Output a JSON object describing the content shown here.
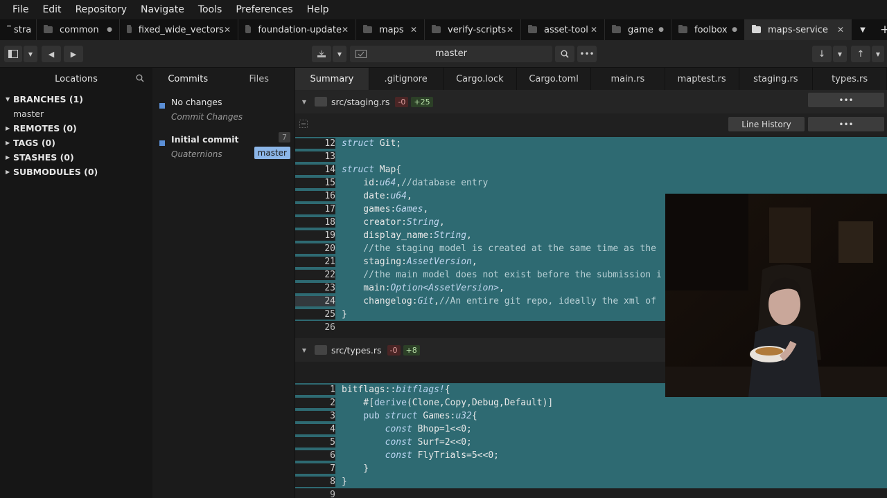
{
  "menu": [
    "File",
    "Edit",
    "Repository",
    "Navigate",
    "Tools",
    "Preferences",
    "Help"
  ],
  "tabs": [
    {
      "label": "stra",
      "mark": "",
      "active": false
    },
    {
      "label": "common",
      "mark": "●",
      "active": false
    },
    {
      "label": "fixed_wide_vectors",
      "mark": "✕",
      "active": false
    },
    {
      "label": "foundation-update",
      "mark": "✕",
      "active": false
    },
    {
      "label": "maps",
      "mark": "✕",
      "active": false
    },
    {
      "label": "verify-scripts",
      "mark": "✕",
      "active": false
    },
    {
      "label": "asset-tool",
      "mark": "✕",
      "active": false
    },
    {
      "label": "game",
      "mark": "●",
      "active": false
    },
    {
      "label": "foolbox",
      "mark": "●",
      "active": false
    },
    {
      "label": "maps-service",
      "mark": "✕",
      "active": true
    }
  ],
  "toolbar": {
    "branch": "master"
  },
  "sidebar": {
    "title": "Locations",
    "branches": "BRANCHES (1)",
    "branch_items": [
      "master"
    ],
    "remotes": "REMOTES (0)",
    "tags": "TAGS (0)",
    "stashes": "STASHES (0)",
    "submodules": "SUBMODULES (0)"
  },
  "commits_panel": {
    "tab_commits": "Commits",
    "tab_files": "Files",
    "items": [
      {
        "title": "No changes",
        "subtitle": "Commit Changes"
      },
      {
        "title": "Initial commit",
        "subtitle": "Quaternions",
        "count": "7",
        "branch": "master"
      }
    ]
  },
  "file_tabs": [
    "Summary",
    ".gitignore",
    "Cargo.lock",
    "Cargo.toml",
    "main.rs",
    "maptest.rs",
    "staging.rs",
    "types.rs"
  ],
  "diff1": {
    "path": "src/staging.rs",
    "del": "-0",
    "add": "+25",
    "line_history": "Line History"
  },
  "diff2": {
    "path": "src/types.rs",
    "del": "-0",
    "add": "+8"
  },
  "ellipsis": "•••"
}
